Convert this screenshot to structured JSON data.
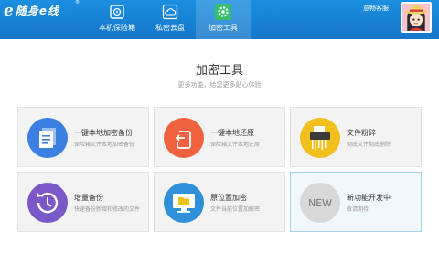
{
  "app": {
    "logo_mark": "e",
    "logo_name": "随身e线",
    "logo_reg": "®"
  },
  "header": {
    "tabs": [
      {
        "label": "本机保险箱",
        "icon": "safe-icon",
        "active": false
      },
      {
        "label": "私密云盘",
        "icon": "cloud-icon",
        "active": false
      },
      {
        "label": "加密工具",
        "icon": "tools-icon",
        "active": true
      }
    ],
    "service_label": "意畅客服",
    "avatar": "avatar"
  },
  "main": {
    "title": "加密工具",
    "subtitle": "更多功能，给您更多贴心体验",
    "cards": [
      {
        "title": "一键本地加密备份",
        "desc": "保险箱文件本地加密备份",
        "icon": "document-backup-icon",
        "color": "#3b7fe0"
      },
      {
        "title": "一键本地还原",
        "desc": "保险箱文件本地还原",
        "icon": "restore-icon",
        "color": "#f0623f"
      },
      {
        "title": "文件粉碎",
        "desc": "彻底文件彻底删除",
        "icon": "shredder-icon",
        "color": "#f2c01c"
      },
      {
        "title": "增量备份",
        "desc": "快速备份新增和修改的文件",
        "icon": "history-clock-icon",
        "color": "#7b58c8"
      },
      {
        "title": "原位置加密",
        "desc": "文件当前位置加解密",
        "icon": "monitor-folder-icon",
        "color": "#2f90d8"
      },
      {
        "title": "新功能开发中",
        "desc": "敬请期待",
        "icon": "new-badge-icon",
        "badge": "NEW",
        "color": "#d8d8d8"
      }
    ]
  }
}
